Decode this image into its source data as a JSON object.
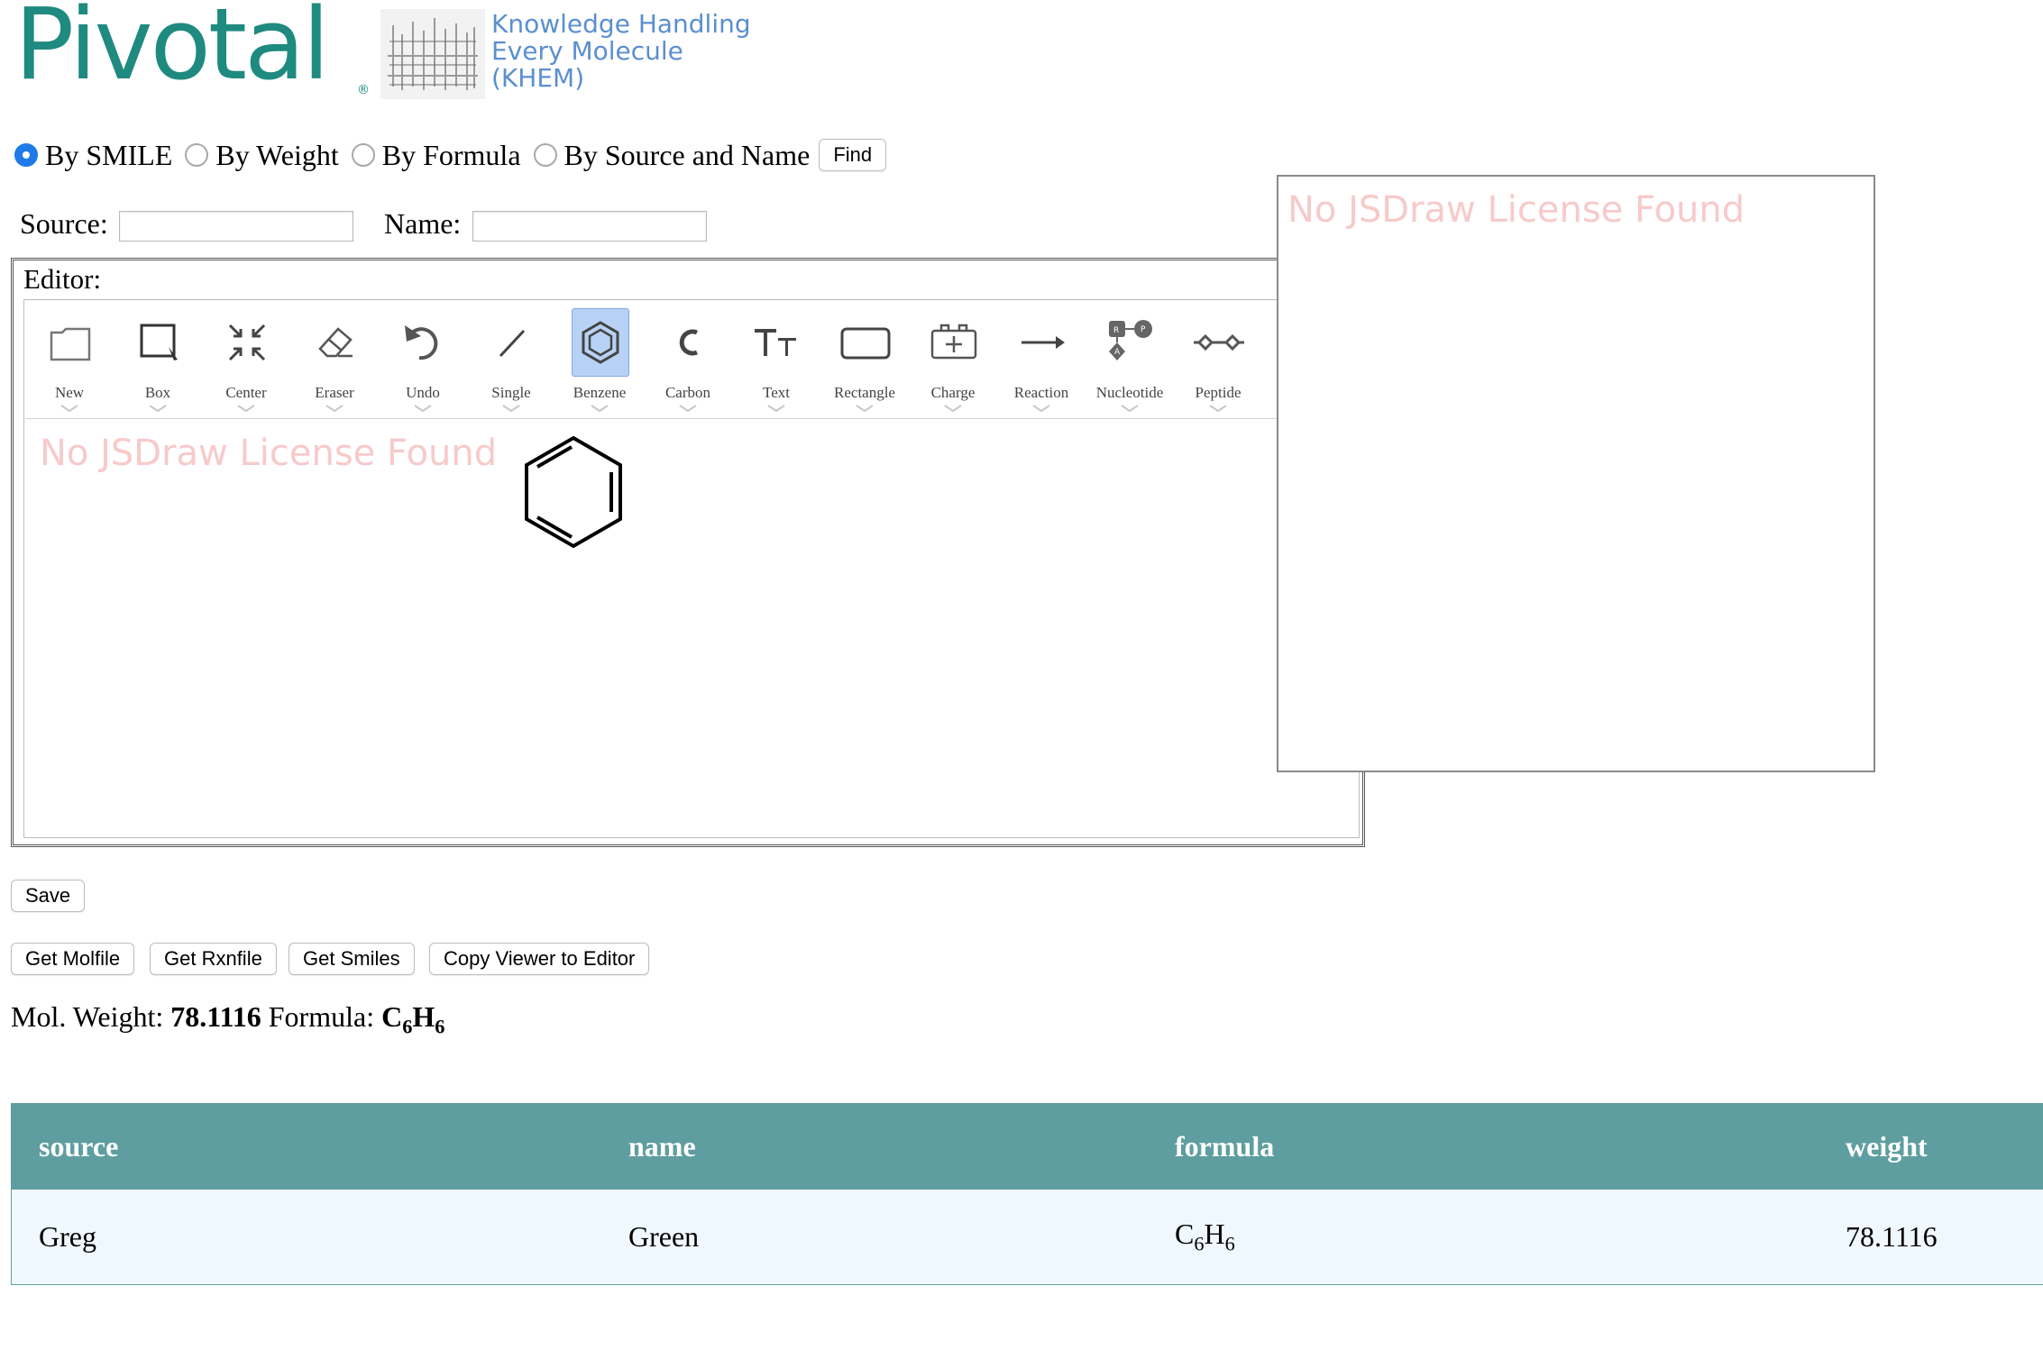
{
  "header": {
    "logo_text": "Pivotal",
    "logo_reg": "®",
    "khem_lines": [
      "Knowledge Handling",
      "Every Molecule",
      "(KHEM)"
    ]
  },
  "search": {
    "options": [
      {
        "label": "By SMILE",
        "selected": true
      },
      {
        "label": "By Weight",
        "selected": false
      },
      {
        "label": "By Formula",
        "selected": false
      },
      {
        "label": "By Source and Name",
        "selected": false
      }
    ],
    "find_label": "Find",
    "source_label": "Source:",
    "source_value": "",
    "name_label": "Name:",
    "name_value": ""
  },
  "editor": {
    "title": "Editor:",
    "tools": [
      {
        "label": "New",
        "icon": "new-icon"
      },
      {
        "label": "Box",
        "icon": "box-select-icon"
      },
      {
        "label": "Center",
        "icon": "center-icon"
      },
      {
        "label": "Eraser",
        "icon": "eraser-icon"
      },
      {
        "label": "Undo",
        "icon": "undo-icon"
      },
      {
        "label": "Single",
        "icon": "single-bond-icon"
      },
      {
        "label": "Benzene",
        "icon": "benzene-icon",
        "active": true
      },
      {
        "label": "Carbon",
        "icon": "carbon-icon"
      },
      {
        "label": "Text",
        "icon": "text-icon"
      },
      {
        "label": "Rectangle",
        "icon": "rectangle-icon"
      },
      {
        "label": "Charge",
        "icon": "charge-icon"
      },
      {
        "label": "Reaction",
        "icon": "reaction-arrow-icon"
      },
      {
        "label": "Nucleotide",
        "icon": "nucleotide-icon"
      },
      {
        "label": "Peptide",
        "icon": "peptide-icon"
      }
    ],
    "watermark": "No JSDraw License Found"
  },
  "viewer": {
    "watermark": "No JSDraw License Found"
  },
  "actions": {
    "save": "Save",
    "get_molfile": "Get Molfile",
    "get_rxnfile": "Get Rxnfile",
    "get_smiles": "Get Smiles",
    "copy_viewer": "Copy Viewer to Editor"
  },
  "result": {
    "weight_label": "Mol. Weight:",
    "weight_value": "78.1116",
    "formula_label": "Formula:",
    "formula": {
      "c": "C",
      "c_n": "6",
      "h": "H",
      "h_n": "6"
    }
  },
  "table": {
    "headers": [
      "source",
      "name",
      "formula",
      "weight"
    ],
    "rows": [
      {
        "source": "Greg",
        "name": "Green",
        "formula": {
          "c": "C",
          "c_n": "6",
          "h": "H",
          "h_n": "6"
        },
        "weight": "78.1116"
      }
    ]
  },
  "colors": {
    "brand_teal": "#1f8a7f",
    "khem_blue": "#5b8fd0",
    "table_header": "#5f9ea0",
    "table_row": "#f0f8ff",
    "watermark": "#f7caca",
    "radio_selected": "#1f7ae8"
  }
}
